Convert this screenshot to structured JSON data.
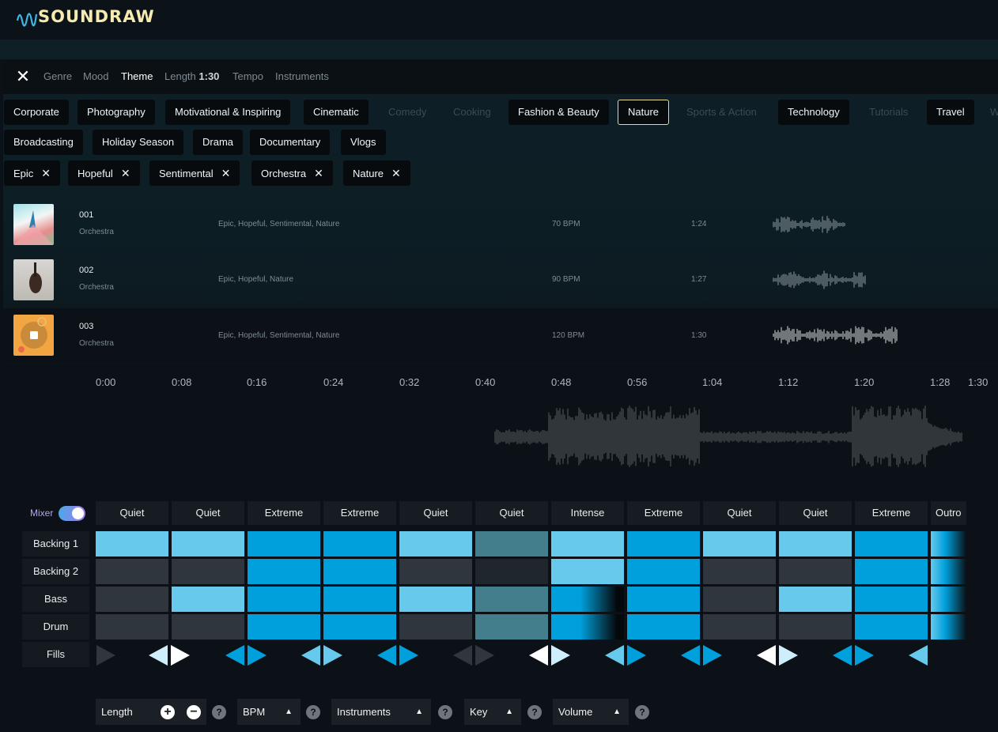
{
  "app": {
    "logo_text": "SOUNDRAW"
  },
  "filters": {
    "tabs": [
      "Genre",
      "Mood",
      "Theme",
      "Length",
      "Tempo",
      "Instruments"
    ],
    "length_value": "1:30",
    "active_tab": "Theme"
  },
  "themes": {
    "row1": [
      "Corporate",
      "Photography",
      "Motivational & Inspiring",
      "Cinematic",
      "Comedy",
      "Cooking",
      "Fashion & Beauty",
      "Nature",
      "Sports & Action",
      "Technology",
      "Tutorials",
      "Travel",
      "W"
    ],
    "row2": [
      "Broadcasting",
      "Holiday Season",
      "Drama",
      "Documentary",
      "Vlogs"
    ],
    "disabled": [
      "Comedy",
      "Cooking",
      "Sports & Action",
      "Tutorials",
      "W"
    ],
    "selected": "Nature"
  },
  "selected_tags": [
    "Epic",
    "Hopeful",
    "Sentimental",
    "Orchestra",
    "Nature"
  ],
  "tracks": [
    {
      "num": "001",
      "instrument": "Orchestra",
      "tags": "Epic, Hopeful, Sentimental, Nature",
      "bpm": "70 BPM",
      "duration": "1:24"
    },
    {
      "num": "002",
      "instrument": "Orchestra",
      "tags": "Epic, Hopeful, Nature",
      "bpm": "90 BPM",
      "duration": "1:27"
    },
    {
      "num": "003",
      "instrument": "Orchestra",
      "tags": "Epic, Hopeful, Sentimental, Nature",
      "bpm": "120 BPM",
      "duration": "1:30"
    }
  ],
  "timeline": [
    "0:00",
    "0:08",
    "0:16",
    "0:24",
    "0:32",
    "0:40",
    "0:48",
    "0:56",
    "1:04",
    "1:12",
    "1:20",
    "1:28",
    "1:30"
  ],
  "player": {
    "progress": 0.56
  },
  "mixer": {
    "label": "Mixer",
    "enabled": true,
    "segments": [
      "Quiet",
      "Quiet",
      "Extreme",
      "Extreme",
      "Quiet",
      "Quiet",
      "Intense",
      "Extreme",
      "Quiet",
      "Quiet",
      "Extreme",
      "Outro"
    ],
    "rows": [
      "Backing 1",
      "Backing 2",
      "Bass",
      "Drum",
      "Fills"
    ],
    "colors": {
      "light": "#67c9ec",
      "dark": "#00a0dc",
      "off": "#30363d",
      "muted": "#437e8d",
      "muted_dark": "#1f272d"
    },
    "grid": [
      [
        "light",
        "light",
        "dark",
        "dark",
        "light",
        "muted",
        "light",
        "dark",
        "light",
        "light",
        "dark",
        "fade"
      ],
      [
        "off",
        "off",
        "dark",
        "dark",
        "off",
        "muted_dark",
        "light",
        "dark",
        "off",
        "off",
        "dark",
        "fade"
      ],
      [
        "off",
        "light",
        "dark",
        "dark",
        "light",
        "muted",
        "darkfade",
        "dark",
        "off",
        "light",
        "dark",
        "fade"
      ],
      [
        "off",
        "off",
        "dark",
        "dark",
        "off",
        "muted",
        "darkfade",
        "dark",
        "off",
        "off",
        "dark",
        "fade"
      ]
    ]
  },
  "controls": {
    "length": "Length",
    "bpm": "BPM",
    "instruments": "Instruments",
    "key": "Key",
    "volume": "Volume",
    "help": "?"
  }
}
